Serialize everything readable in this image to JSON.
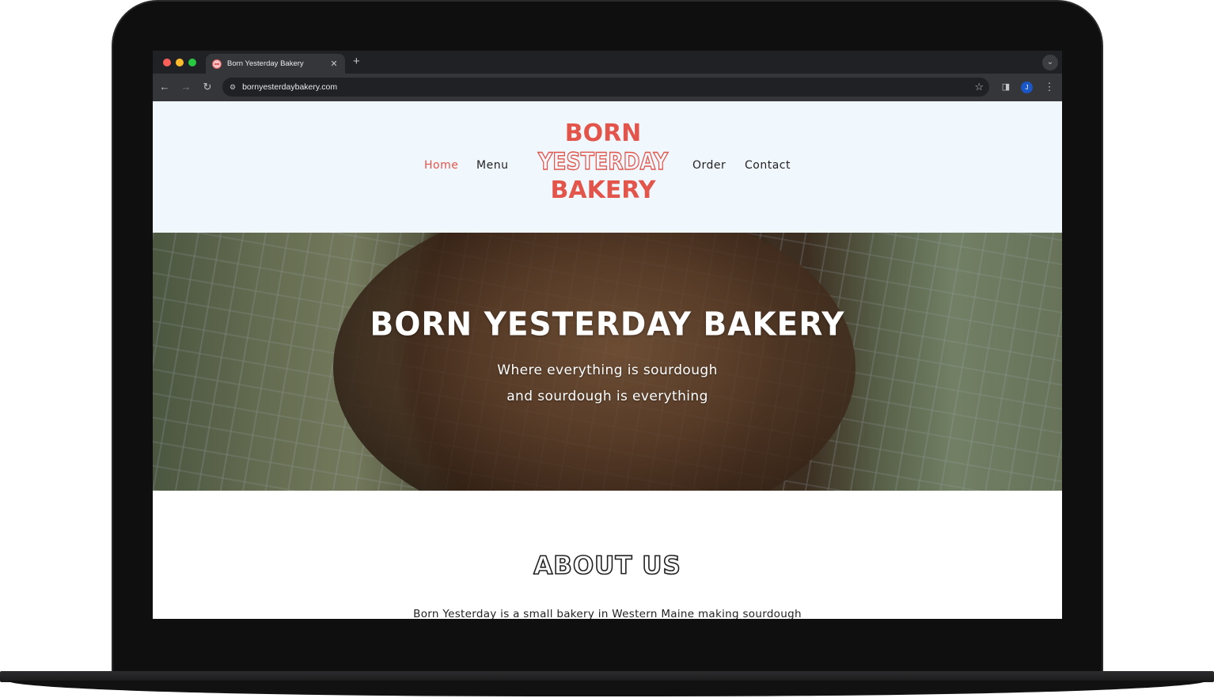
{
  "browser": {
    "tab_title": "Born Yesterday Bakery",
    "tab_close": "✕",
    "new_tab": "+",
    "url": "bornyesterdaybakery.com",
    "profile_initial": "J"
  },
  "site": {
    "nav": {
      "home": "Home",
      "menu": "Menu",
      "order": "Order",
      "contact": "Contact"
    },
    "logo": {
      "line1": "BORN",
      "line2": "YESTERDAY",
      "line3": "BAKERY",
      "color": "#e3554b"
    },
    "hero": {
      "title": "BORN YESTERDAY BAKERY",
      "subtitle_line1": "Where everything is sourdough",
      "subtitle_line2": "and sourdough is everything"
    },
    "about": {
      "title": "ABOUT US",
      "text": "Born Yesterday is a small bakery in Western Maine making sourdough"
    }
  },
  "colors": {
    "accent": "#e3554b",
    "header_bg": "#f0f7fd"
  }
}
